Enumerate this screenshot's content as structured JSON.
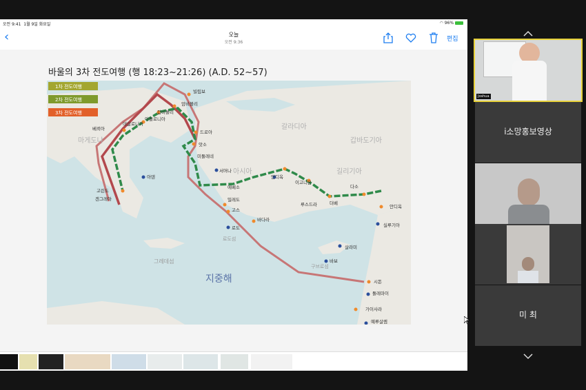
{
  "ipad": {
    "status_time": "오전 9:41",
    "status_date": "1월 9일 화요일",
    "battery": "96%",
    "nav_title": "오늘",
    "nav_subtitle": "오전 9:36",
    "edit_label": "편집",
    "icons": [
      "chevron-left-icon",
      "share-icon",
      "heart-icon",
      "trash-icon"
    ]
  },
  "slide": {
    "title": "바울의 3차 전도여행 (행 18:23~21:26) (A.D. 52~57)",
    "legend": [
      "1차 전도여행",
      "2차 전도여행",
      "3차 전도여행"
    ],
    "legend_colors": [
      "#a3a630",
      "#7f9a2c",
      "#e2602a"
    ],
    "route_colors": {
      "first": "#b3484d",
      "second": "#2f8a4a",
      "third": "#c77676"
    },
    "sea_label": "지중해",
    "region_labels": [
      "마게도냐",
      "갈라디아",
      "갑바도기아",
      "아시아",
      "길리기아",
      "그레데섬",
      "구브로섬",
      "로도섬"
    ],
    "cities": [
      "빌립보",
      "암비볼리",
      "갑비볼리",
      "아볼로니아",
      "데살로니가",
      "베뢰아",
      "드로아",
      "앗소",
      "미둘레네",
      "서머나",
      "에베소",
      "밀레도",
      "고스",
      "바다라",
      "로도",
      "아덴",
      "고린도",
      "겐그레아",
      "안디옥",
      "이고니온",
      "루스드라",
      "더베",
      "다소",
      "안디옥",
      "실루기아",
      "살라미",
      "바보",
      "시돈",
      "돌레마이",
      "가이사라",
      "예루살렘"
    ]
  },
  "panel": {
    "tiles": [
      {
        "name": "Joshua",
        "type": "video"
      },
      {
        "name": "i소망홍보영상",
        "type": "name"
      },
      {
        "name": "",
        "type": "video"
      },
      {
        "name": "",
        "type": "video"
      },
      {
        "name": "미 최",
        "type": "name"
      }
    ],
    "icons": [
      "chevron-up-icon",
      "chevron-down-icon"
    ]
  }
}
